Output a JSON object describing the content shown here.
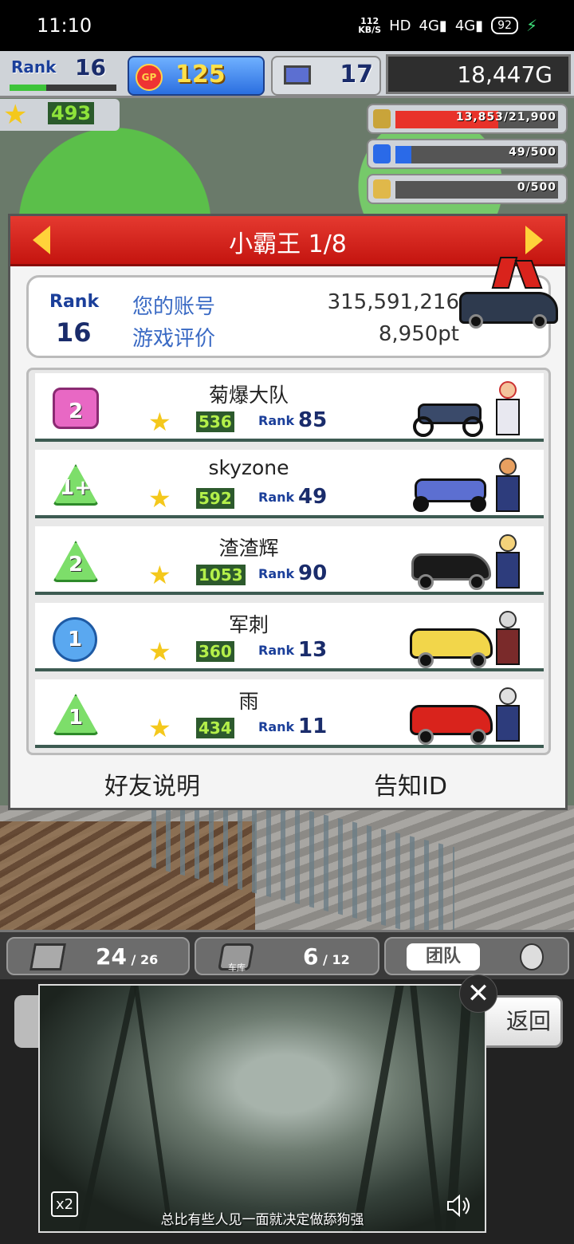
{
  "status_bar": {
    "time": "11:10",
    "net_speed_value": "112",
    "net_speed_unit": "KB/S",
    "hd": "HD",
    "signal_1": "4G",
    "signal_2": "4G",
    "battery": "92"
  },
  "hud": {
    "rank_label": "Rank",
    "rank_value": "16",
    "gp_icon_text": "GP",
    "gp_value": "125",
    "pc_value": "17",
    "money": "18,447G",
    "star_value": "493",
    "resources": [
      {
        "icon": "coin-stack-icon",
        "text": "13,853/21,900",
        "level": 0.63,
        "color": "#e8322a"
      },
      {
        "icon": "fuel-can-icon",
        "text": "49/500",
        "level": 0.1,
        "color": "#2a6ae8"
      },
      {
        "icon": "wheat-icon",
        "text": "0/500",
        "level": 0,
        "color": "#c9a43a"
      }
    ]
  },
  "dialog": {
    "title": "小霸王 1/8",
    "account": {
      "rank_label": "Rank",
      "rank_value": "16",
      "account_label": "您的账号",
      "account_value": "315,591,216",
      "rating_label": "游戏评价",
      "rating_value": "8,950pt"
    },
    "friends": [
      {
        "badge": "2",
        "badge_shape": "square",
        "badge_color": "#e868c4",
        "name": "菊爆大队",
        "score": "536",
        "rank_label": "Rank",
        "rank": "85",
        "vehicle": "motorcycle"
      },
      {
        "badge": "1+",
        "badge_shape": "tri",
        "badge_color": "#7dde6a",
        "name": "skyzone",
        "score": "592",
        "rank_label": "Rank",
        "rank": "49",
        "vehicle": "kart"
      },
      {
        "badge": "2",
        "badge_shape": "tri",
        "badge_color": "#7dde6a",
        "name": "渣渣辉",
        "score": "1053",
        "rank_label": "Rank",
        "rank": "90",
        "vehicle": "sports-car"
      },
      {
        "badge": "1",
        "badge_shape": "circle",
        "badge_color": "#5aa8f0",
        "name": "军刺",
        "score": "360",
        "rank_label": "Rank",
        "rank": "13",
        "vehicle": "taxi"
      },
      {
        "badge": "1",
        "badge_shape": "tri",
        "badge_color": "#7dde6a",
        "name": "雨",
        "score": "434",
        "rank_label": "Rank",
        "rank": "11",
        "vehicle": "red-car"
      }
    ],
    "friend_help_label": "好友说明",
    "notify_id_label": "告知ID"
  },
  "bottom_hud": {
    "buildings_count": "24",
    "buildings_max": "26",
    "garage_label": "车库",
    "garage_count": "6",
    "garage_max": "12",
    "team_label": "团队",
    "return_label": "返回"
  },
  "video_ad": {
    "speed_label": "x2",
    "subtitle": "总比有些人见一面就决定做舔狗强"
  }
}
